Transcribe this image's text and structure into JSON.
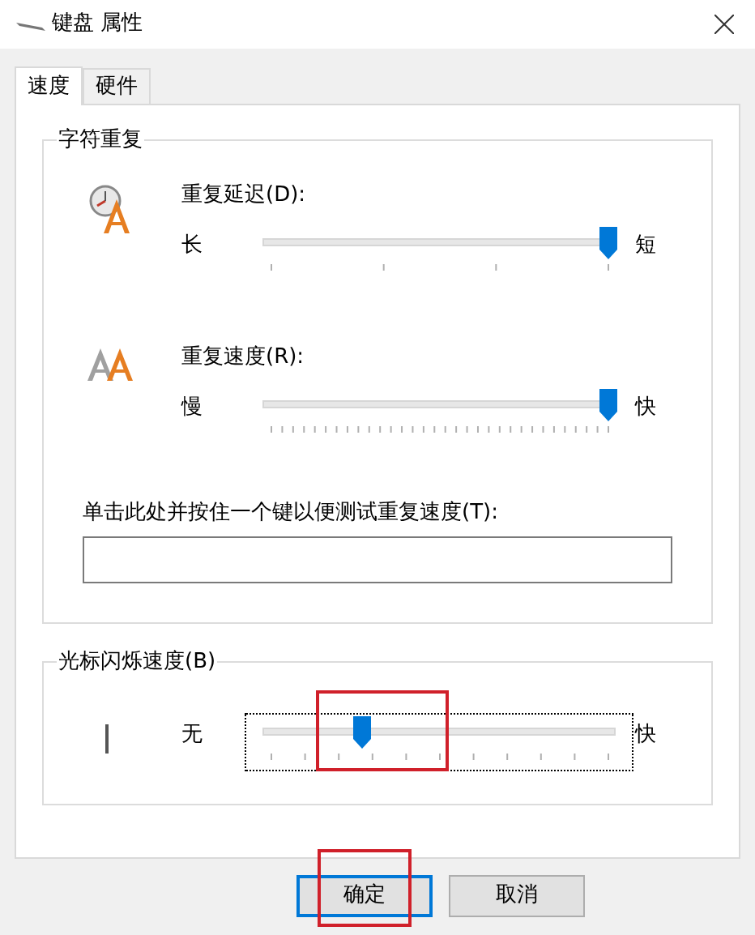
{
  "window": {
    "title": "键盘 属性"
  },
  "tabs": [
    {
      "label": "速度",
      "selected": true
    },
    {
      "label": "硬件",
      "selected": false
    }
  ],
  "character_repeat": {
    "title": "字符重复",
    "sliders": [
      {
        "label": "重复延迟(D):",
        "min_label": "长",
        "max_label": "短",
        "level": 1.0
      },
      {
        "label": "重复速度(R):",
        "min_label": "慢",
        "max_label": "快",
        "level": 1.0
      }
    ],
    "test_label": "单击此处并按住一个键以便测试重复速度(T):"
  },
  "cursor_blink": {
    "title": "光标闪烁速度(B)",
    "min_label": "无",
    "max_label": "快",
    "level": 0.27,
    "focused": true
  },
  "buttons": [
    {
      "label": "确定",
      "default": true
    },
    {
      "label": "取消",
      "default": false
    }
  ]
}
